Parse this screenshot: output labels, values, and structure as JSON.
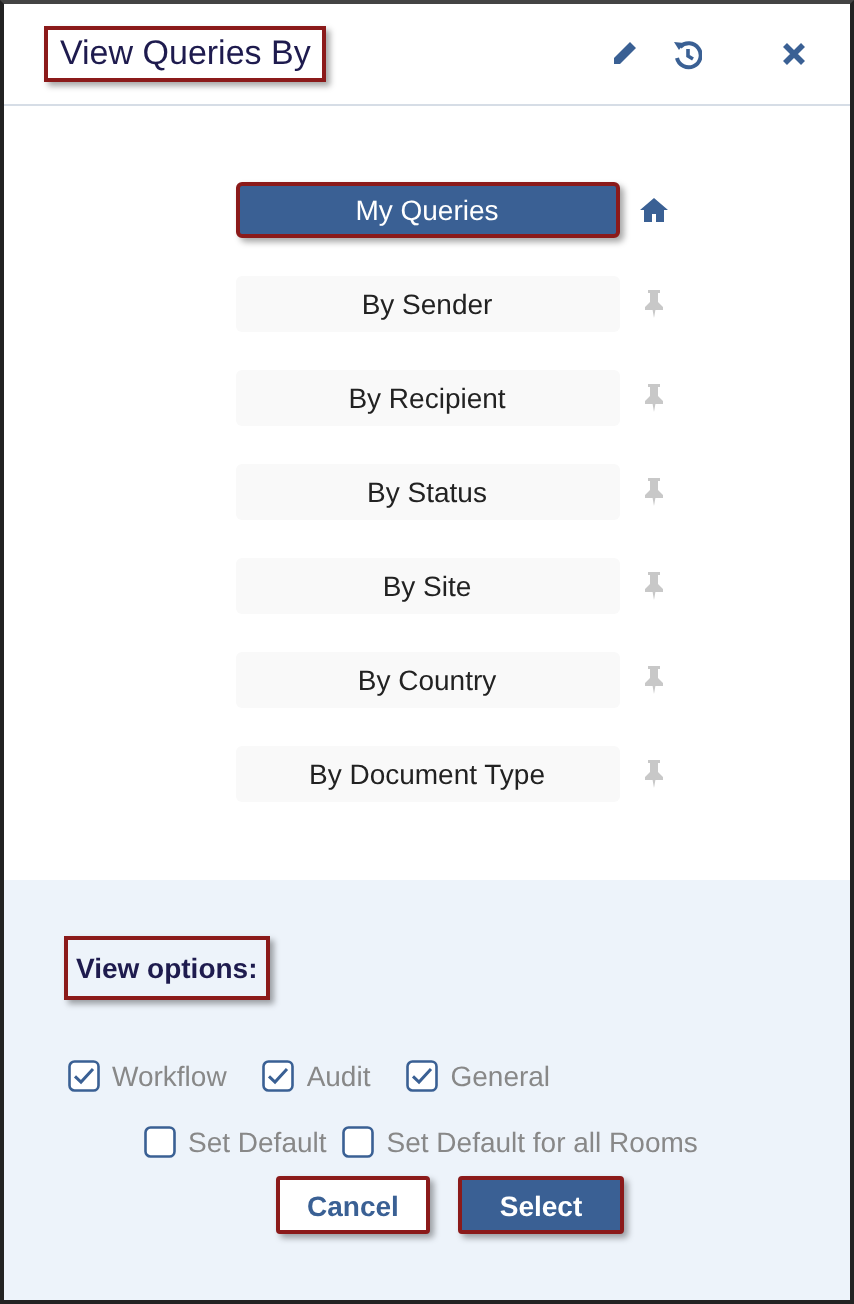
{
  "window": {
    "title": "View Queries By",
    "title_highlighted": true
  },
  "menu": [
    {
      "label": "My Queries",
      "selected": true,
      "default": true,
      "highlighted": true
    },
    {
      "label": "By Sender",
      "selected": false,
      "default": false,
      "highlighted": false
    },
    {
      "label": "By Recipient",
      "selected": false,
      "default": false,
      "highlighted": false
    },
    {
      "label": "By Status",
      "selected": false,
      "default": false,
      "highlighted": false
    },
    {
      "label": "By Site",
      "selected": false,
      "default": false,
      "highlighted": false
    },
    {
      "label": "By Country",
      "selected": false,
      "default": false,
      "highlighted": false
    },
    {
      "label": "By Document Type",
      "selected": false,
      "default": false,
      "highlighted": false
    }
  ],
  "view_options": {
    "heading": "View options:",
    "highlighted": true,
    "types": [
      {
        "label": "Workflow",
        "checked": true
      },
      {
        "label": "Audit",
        "checked": true
      },
      {
        "label": "General",
        "checked": true
      }
    ],
    "defaults": [
      {
        "label": "Set Default",
        "checked": false
      },
      {
        "label": "Set Default for all Rooms",
        "checked": false
      }
    ]
  },
  "buttons": [
    {
      "label": "Cancel",
      "kind": "secondary",
      "highlighted": true
    },
    {
      "label": "Select",
      "kind": "primary",
      "highlighted": true
    }
  ]
}
